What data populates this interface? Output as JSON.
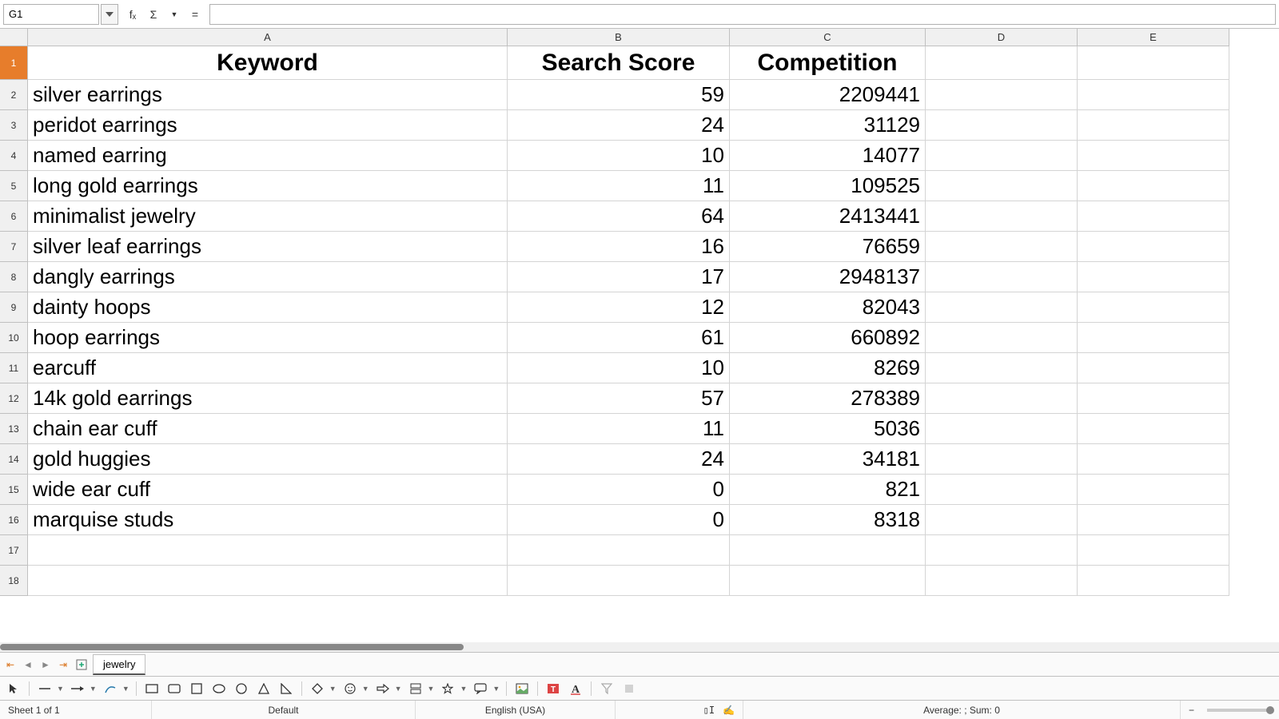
{
  "formula_bar": {
    "cell_ref": "G1",
    "fx_label": "fₓ",
    "sigma_label": "Σ",
    "equals_label": "=",
    "input_value": ""
  },
  "columns": [
    "A",
    "B",
    "C",
    "D",
    "E"
  ],
  "header_row": {
    "keyword": "Keyword",
    "search_score": "Search Score",
    "competition": "Competition"
  },
  "rows": [
    {
      "keyword": "silver earrings",
      "search_score": "59",
      "competition": "2209441"
    },
    {
      "keyword": "peridot earrings",
      "search_score": "24",
      "competition": "31129"
    },
    {
      "keyword": "named earring",
      "search_score": "10",
      "competition": "14077"
    },
    {
      "keyword": "long gold earrings",
      "search_score": "11",
      "competition": "109525"
    },
    {
      "keyword": "minimalist jewelry",
      "search_score": "64",
      "competition": "2413441"
    },
    {
      "keyword": "silver leaf earrings",
      "search_score": "16",
      "competition": "76659"
    },
    {
      "keyword": "dangly earrings",
      "search_score": "17",
      "competition": "2948137"
    },
    {
      "keyword": "dainty hoops",
      "search_score": "12",
      "competition": "82043"
    },
    {
      "keyword": "hoop earrings",
      "search_score": "61",
      "competition": "660892"
    },
    {
      "keyword": "earcuff",
      "search_score": "10",
      "competition": "8269"
    },
    {
      "keyword": "14k gold earrings",
      "search_score": "57",
      "competition": "278389"
    },
    {
      "keyword": "chain ear cuff",
      "search_score": "11",
      "competition": "5036"
    },
    {
      "keyword": "gold huggies",
      "search_score": "24",
      "competition": "34181"
    },
    {
      "keyword": "wide ear cuff",
      "search_score": "0",
      "competition": "821"
    },
    {
      "keyword": "marquise studs",
      "search_score": "0",
      "competition": "8318"
    }
  ],
  "empty_visible_rows": 2,
  "sheet_tab": "jewelry",
  "status": {
    "sheet_info": "Sheet 1 of 1",
    "style": "Default",
    "language": "English (USA)",
    "summary": "Average: ; Sum: 0"
  },
  "chart_data": {
    "type": "table",
    "columns": [
      "Keyword",
      "Search Score",
      "Competition"
    ],
    "data": [
      [
        "silver earrings",
        59,
        2209441
      ],
      [
        "peridot earrings",
        24,
        31129
      ],
      [
        "named earring",
        10,
        14077
      ],
      [
        "long gold earrings",
        11,
        109525
      ],
      [
        "minimalist jewelry",
        64,
        2413441
      ],
      [
        "silver leaf earrings",
        16,
        76659
      ],
      [
        "dangly earrings",
        17,
        2948137
      ],
      [
        "dainty hoops",
        12,
        82043
      ],
      [
        "hoop earrings",
        61,
        660892
      ],
      [
        "earcuff",
        10,
        8269
      ],
      [
        "14k gold earrings",
        57,
        278389
      ],
      [
        "chain ear cuff",
        11,
        5036
      ],
      [
        "gold huggies",
        24,
        34181
      ],
      [
        "wide ear cuff",
        0,
        821
      ],
      [
        "marquise studs",
        0,
        8318
      ]
    ]
  }
}
